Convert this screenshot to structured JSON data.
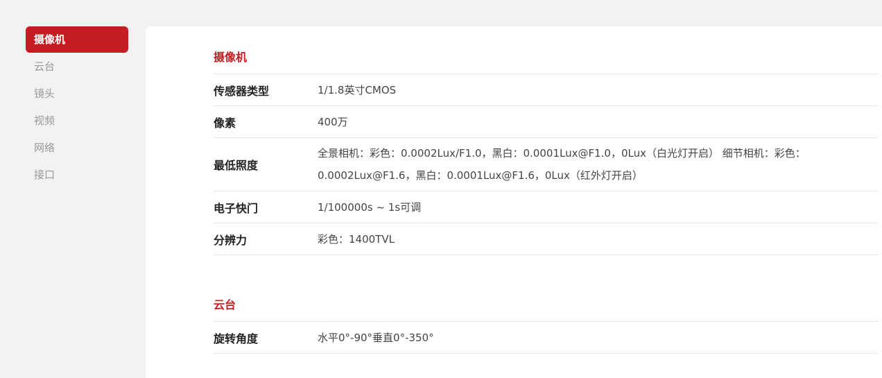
{
  "colors": {
    "accent": "#c61c23"
  },
  "sidebar": {
    "items": [
      {
        "label": "摄像机",
        "active": true
      },
      {
        "label": "云台",
        "active": false
      },
      {
        "label": "镜头",
        "active": false
      },
      {
        "label": "视频",
        "active": false
      },
      {
        "label": "网络",
        "active": false
      },
      {
        "label": "接口",
        "active": false
      }
    ]
  },
  "sections": [
    {
      "title": "摄像机",
      "rows": [
        {
          "label": "传感器类型",
          "value": "1/1.8英寸CMOS"
        },
        {
          "label": "像素",
          "value": "400万"
        },
        {
          "label": "最低照度",
          "value_line1": "全景相机：彩色：0.0002Lux/F1.0，黑白：0.0001Lux@F1.0，0Lux（白光灯开启） 细节相机：彩色：",
          "value_line2": "0.0002Lux@F1.6，黑白：0.0001Lux@F1.6，0Lux（红外灯开启）"
        },
        {
          "label": "电子快门",
          "value": "1/100000s ~ 1s可调"
        },
        {
          "label": "分辨力",
          "value": "彩色：1400TVL"
        }
      ]
    },
    {
      "title": "云台",
      "rows": [
        {
          "label": "旋转角度",
          "value": "水平0°-90°垂直0°-350°"
        }
      ]
    }
  ]
}
